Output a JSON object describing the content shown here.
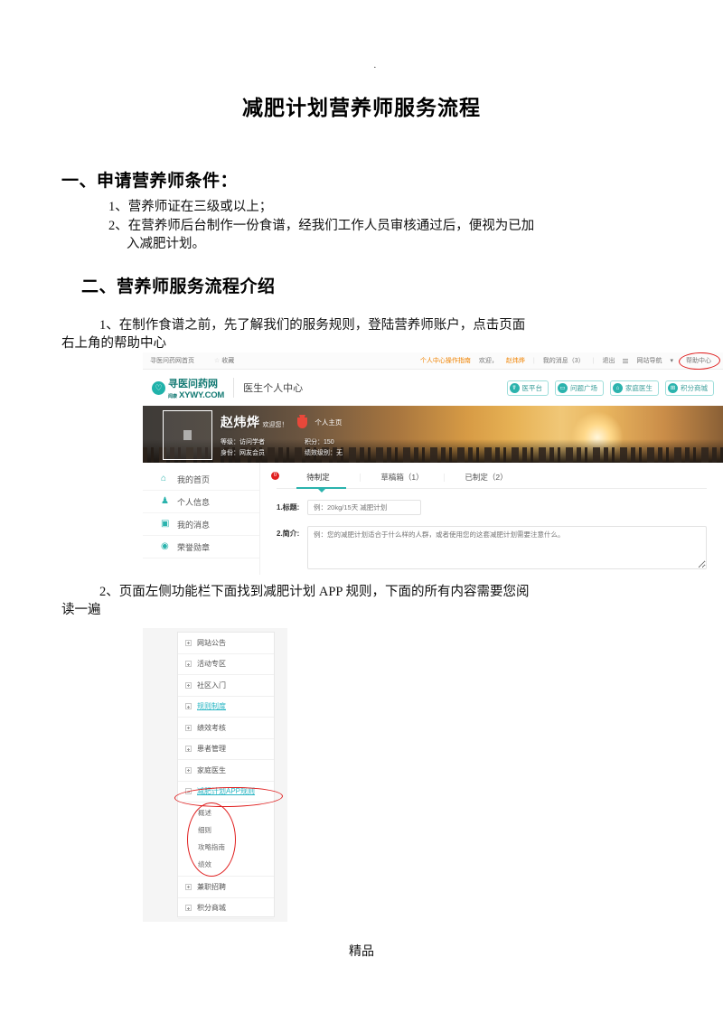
{
  "document": {
    "top_mark": "·",
    "title": "减肥计划营养师服务流程",
    "footer": "精品",
    "headings": {
      "section1": "一、申请营养师条件：",
      "section2": "二、营养师服务流程介绍"
    },
    "conditions": [
      "1、营养师证在三级或以上；",
      "2、在营养师后台制作一份食谱，经我们工作人员审核通过后，便视为已加",
      "入减肥计划。"
    ],
    "steps": {
      "step1_line1": "1、在制作食谱之前，先了解我们的服务规则，登陆营养师账户，点击页面",
      "step1_line2": "右上角的帮助中心",
      "step2_line1": "2、页面左侧功能栏下面找到减肥计划 APP 规则，下面的所有内容需要您阅",
      "step2_line2": "读一遍"
    }
  },
  "screenshot1": {
    "topbar": {
      "home_link": "寻医问药网首页",
      "favorite": "收藏",
      "star_icon": "star-icon",
      "guide_link": "个人中心操作指南",
      "welcome": "欢迎，",
      "username": "赵炜烨",
      "messages": "我的消息（3）",
      "logout": "退出",
      "site_nav": "网站导航",
      "nav_caret": "▾",
      "help_center": "帮助中心",
      "sep": "|"
    },
    "header": {
      "logo_icon": "xywy-logo-icon",
      "logo_cn": "寻医问药网",
      "logo_en": "XYWY.COM",
      "logo_sub": "闻康",
      "page_title": "医生个人中心",
      "nav_buttons": [
        {
          "icon": "doctor-icon",
          "glyph": "☤",
          "label": "医平台"
        },
        {
          "icon": "chat-icon",
          "glyph": "💬",
          "label": "问题广场"
        },
        {
          "icon": "home-icon",
          "glyph": "⌂",
          "label": "家庭医生"
        },
        {
          "icon": "cart-icon",
          "glyph": "🛒",
          "label": "积分商城"
        }
      ]
    },
    "banner": {
      "avatar_icon": "avatar-placeholder-icon",
      "name": "赵炜烨",
      "welcome_suffix": "欢迎您！",
      "medal_icon": "medal-icon",
      "home_link": "个人主页",
      "level_label": "等级：访问学者",
      "points_label": "积分：150",
      "identity_label": "身份：网友会员",
      "performance_label": "绩效级别：无"
    },
    "sidebar": [
      {
        "icon": "home-icon",
        "glyph": "⌂",
        "label": "我的首页"
      },
      {
        "icon": "user-icon",
        "glyph": "♟",
        "label": "个人信息"
      },
      {
        "icon": "message-icon",
        "glyph": "▣",
        "label": "我的消息"
      },
      {
        "icon": "medal-icon",
        "glyph": "◉",
        "label": "荣誉勋章"
      }
    ],
    "tabs": [
      {
        "label": "待制定",
        "badge": "0",
        "active": true
      },
      {
        "label": "草稿箱（1）",
        "active": false
      },
      {
        "label": "已制定（2）",
        "active": false
      }
    ],
    "form": {
      "title_label": "1.标题:",
      "title_placeholder": "例：20kg/15天 减肥计划",
      "title_value": "",
      "desc_label": "2.简介:",
      "desc_placeholder": "例：您的减肥计划适合于什么样的人群，或者使用您的这套减肥计划需要注意什么。",
      "desc_value": ""
    },
    "accent_color": "#2bb3ad",
    "annotation_color": "#e02020"
  },
  "screenshot2": {
    "menu": [
      {
        "label": "网站公告",
        "expanded": false,
        "highlighted": false
      },
      {
        "label": "活动专区",
        "expanded": false,
        "highlighted": false
      },
      {
        "label": "社区入门",
        "expanded": false,
        "highlighted": false
      },
      {
        "label": "规则制度",
        "expanded": false,
        "highlighted": true
      },
      {
        "label": "绩效考核",
        "expanded": false,
        "highlighted": false
      },
      {
        "label": "患者管理",
        "expanded": false,
        "highlighted": false
      },
      {
        "label": "家庭医生",
        "expanded": false,
        "highlighted": false
      }
    ],
    "expanded_item": {
      "label": "减肥计划APP规则",
      "expanded": true,
      "highlighted": true
    },
    "sub_items": [
      "概述",
      "细则",
      "攻略指南",
      "绩效"
    ],
    "menu_after": [
      {
        "label": "兼职招聘",
        "expanded": false,
        "highlighted": false
      },
      {
        "label": "积分商城",
        "expanded": false,
        "highlighted": false
      }
    ],
    "annotation_color": "#e02020"
  }
}
